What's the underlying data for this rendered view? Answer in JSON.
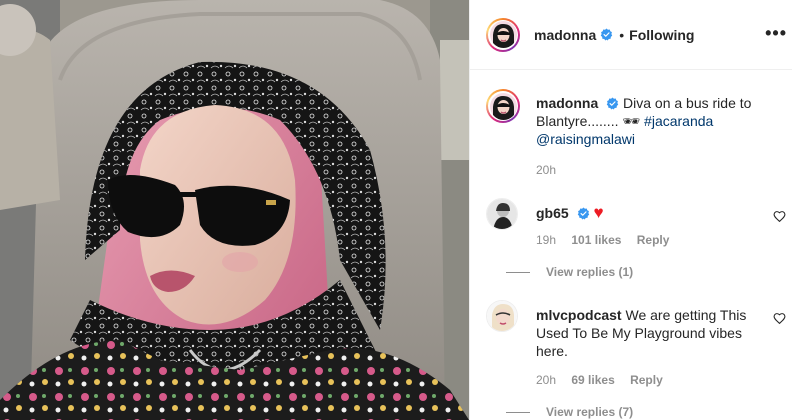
{
  "header": {
    "username": "madonna",
    "separator": "•",
    "follow_state": "Following",
    "more_label": "•••"
  },
  "caption": {
    "username": "madonna",
    "text_1": "Diva on a bus ride to Blantyre........",
    "emoji": "🕶",
    "hashtag": "#jacaranda",
    "mention": "@raisingmalawi",
    "time": "20h"
  },
  "comments": [
    {
      "username": "gb65",
      "text": "",
      "emoji": "♥",
      "time": "19h",
      "likes": "101 likes",
      "reply": "Reply",
      "view_replies": "View replies (1)"
    },
    {
      "username": "mlvcpodcast",
      "text": "We are getting This Used To Be My Playground vibes here.",
      "time": "20h",
      "likes": "69 likes",
      "reply": "Reply",
      "view_replies": "View replies (7)"
    }
  ],
  "colors": {
    "text": "#262626",
    "muted": "#8e8e8e",
    "link": "#00376b",
    "verified": "#3897f0",
    "heart": "#ed4956"
  },
  "icons": [
    "verified-badge-icon",
    "more-options-icon",
    "like-heart-icon",
    "heart-emoji-icon",
    "sunglasses-emoji-icon"
  ]
}
